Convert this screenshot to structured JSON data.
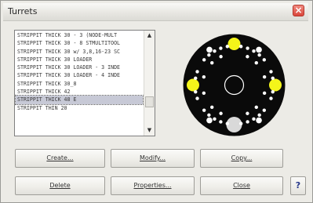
{
  "window": {
    "title": "Turrets",
    "close_glyph": "×"
  },
  "turret_list": {
    "items": [
      "STRIPPIT THICK 30 - 3 (NODE-MULT",
      "STRIPPIT THICK 30 - 8 STMULTITOOL",
      "STRIPPIT THICK 30 w/ 3,8,16-23 SC",
      "STRIPPIT THICK 30 LOADER",
      "STRIPPIT THICK 30 LOADER - 3 INDE",
      "STRIPPIT THICK 30 LOADER - 4 INDE",
      "STRIPPIT THICK 30_8",
      "STRIPPIT THICK 42",
      "STRIPPIT THICK 48 E",
      "STRIPPIT THIN 20"
    ],
    "selected_index": 8,
    "scroll_up_glyph": "▲",
    "scroll_down_glyph": "▼"
  },
  "turret_preview": {
    "icon": "turret-diagram",
    "colors": {
      "disk": "#0a0a0a",
      "station_large": "#f4f51a",
      "station_small": "#ffffff",
      "station_bottom": "#d9d9d9"
    }
  },
  "buttons": {
    "create": "Create...",
    "modify": "Modify...",
    "copy": "Copy...",
    "delete": "Delete",
    "properties": "Properties...",
    "close": "Close",
    "help": "?"
  }
}
